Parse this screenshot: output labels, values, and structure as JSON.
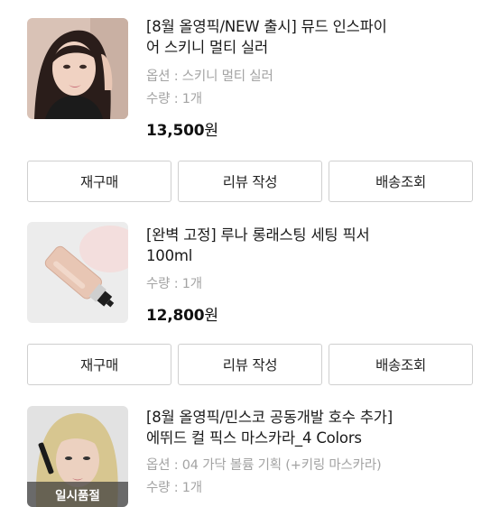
{
  "orders": [
    {
      "title": "[8월 올영픽/NEW 출시] 뮤드 인스파이어 스키니 멀티 실러",
      "title_line1": "[8월 올영픽/NEW 출시] 뮤드 인스파이",
      "title_line2": "어 스키니 멀티 실러",
      "option": "옵션 : 스키니 멀티 실러",
      "quantity": "수량 : 1개",
      "price": "13,500",
      "currency": "원",
      "image_icon": "product-photo-model"
    },
    {
      "title": "[완벽 고정] 루나 롱래스팅 세팅 픽서 100ml",
      "title_line1": "[완벽 고정] 루나 롱래스팅 세팅 픽서",
      "title_line2": "100ml",
      "quantity": "수량 : 1개",
      "price": "12,800",
      "currency": "원",
      "image_icon": "product-photo-spray-bottle"
    },
    {
      "title": "[8월 올영픽/민스코 공동개발 호수 추가] 에뛰드 컬 픽스 마스카라_4 Colors",
      "title_line1": "[8월 올영픽/민스코 공동개발 호수 추가]",
      "title_line2": "에뛰드 컬 픽스 마스카라_4 Colors",
      "option": "옵션 : 04 가닥 볼륨 기획 (+키링 마스카라)",
      "quantity": "수량 : 1개",
      "badge": "일시품절",
      "image_icon": "product-photo-model"
    }
  ],
  "actions": {
    "rebuy": "재구매",
    "review": "리뷰 작성",
    "tracking": "배송조회"
  }
}
